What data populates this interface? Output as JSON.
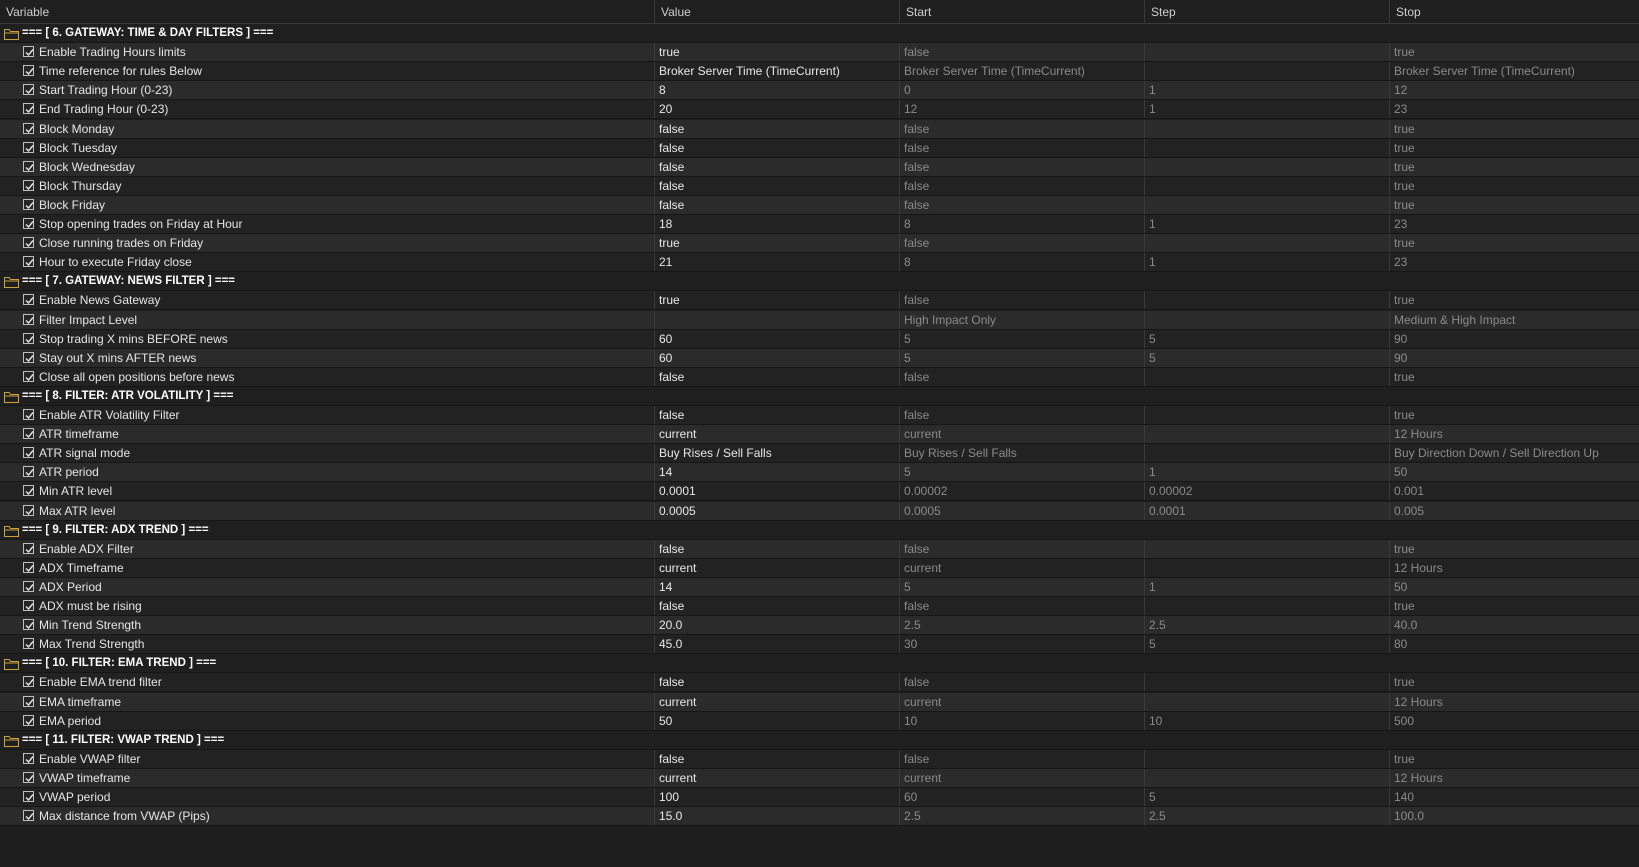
{
  "columns": [
    "Variable",
    "Value",
    "Start",
    "Step",
    "Stop"
  ],
  "rows": [
    {
      "type": "section",
      "title": "=== [ 6. GATEWAY: TIME & DAY FILTERS ] ==="
    },
    {
      "type": "param",
      "name": "Enable Trading Hours limits",
      "value": "true",
      "start": "false",
      "step": "",
      "stop": "true"
    },
    {
      "type": "param",
      "name": "Time reference for rules Below",
      "value": "Broker Server Time (TimeCurrent)",
      "start": "Broker Server Time (TimeCurrent)",
      "step": "",
      "stop": "Broker Server Time (TimeCurrent)"
    },
    {
      "type": "param",
      "name": "Start Trading Hour (0-23)",
      "value": "8",
      "start": "0",
      "step": "1",
      "stop": "12"
    },
    {
      "type": "param",
      "name": "End Trading Hour (0-23)",
      "value": "20",
      "start": "12",
      "step": "1",
      "stop": "23"
    },
    {
      "type": "param",
      "name": "Block Monday",
      "value": "false",
      "start": "false",
      "step": "",
      "stop": "true"
    },
    {
      "type": "param",
      "name": "Block Tuesday",
      "value": "false",
      "start": "false",
      "step": "",
      "stop": "true"
    },
    {
      "type": "param",
      "name": "Block Wednesday",
      "value": "false",
      "start": "false",
      "step": "",
      "stop": "true"
    },
    {
      "type": "param",
      "name": "Block Thursday",
      "value": "false",
      "start": "false",
      "step": "",
      "stop": "true"
    },
    {
      "type": "param",
      "name": "Block Friday",
      "value": "false",
      "start": "false",
      "step": "",
      "stop": "true"
    },
    {
      "type": "param",
      "name": "Stop opening trades on Friday at Hour",
      "value": "18",
      "start": "8",
      "step": "1",
      "stop": "23"
    },
    {
      "type": "param",
      "name": "Close running trades on Friday",
      "value": "true",
      "start": "false",
      "step": "",
      "stop": "true"
    },
    {
      "type": "param",
      "name": "Hour to execute Friday close",
      "value": "21",
      "start": "8",
      "step": "1",
      "stop": "23"
    },
    {
      "type": "section",
      "title": "=== [ 7. GATEWAY: NEWS FILTER ] ==="
    },
    {
      "type": "param",
      "name": "Enable News Gateway",
      "value": "true",
      "start": "false",
      "step": "",
      "stop": "true"
    },
    {
      "type": "param",
      "name": "Filter Impact Level",
      "value": "",
      "start": "High Impact Only",
      "step": "",
      "stop": "Medium & High Impact"
    },
    {
      "type": "param",
      "name": "Stop trading X mins BEFORE news",
      "value": "60",
      "start": "5",
      "step": "5",
      "stop": "90"
    },
    {
      "type": "param",
      "name": "Stay out X mins AFTER news",
      "value": "60",
      "start": "5",
      "step": "5",
      "stop": "90"
    },
    {
      "type": "param",
      "name": "Close all open positions before news",
      "value": "false",
      "start": "false",
      "step": "",
      "stop": "true"
    },
    {
      "type": "section",
      "title": "=== [ 8. FILTER: ATR VOLATILITY ] ==="
    },
    {
      "type": "param",
      "name": "Enable ATR Volatility Filter",
      "value": "false",
      "start": "false",
      "step": "",
      "stop": "true"
    },
    {
      "type": "param",
      "name": "ATR timeframe",
      "value": "current",
      "start": "current",
      "step": "",
      "stop": "12 Hours"
    },
    {
      "type": "param",
      "name": "ATR signal mode",
      "value": "Buy Rises / Sell Falls",
      "start": "Buy Rises / Sell Falls",
      "step": "",
      "stop": "Buy Direction Down / Sell Direction Up"
    },
    {
      "type": "param",
      "name": "ATR period",
      "value": "14",
      "start": "5",
      "step": "1",
      "stop": "50"
    },
    {
      "type": "param",
      "name": "Min ATR level",
      "value": "0.0001",
      "start": "0.00002",
      "step": "0.00002",
      "stop": "0.001"
    },
    {
      "type": "param",
      "name": "Max ATR level",
      "value": "0.0005",
      "start": "0.0005",
      "step": "0.0001",
      "stop": "0.005"
    },
    {
      "type": "section",
      "title": "=== [ 9. FILTER: ADX TREND ] ==="
    },
    {
      "type": "param",
      "name": "Enable ADX Filter",
      "value": "false",
      "start": "false",
      "step": "",
      "stop": "true"
    },
    {
      "type": "param",
      "name": "ADX Timeframe",
      "value": "current",
      "start": "current",
      "step": "",
      "stop": "12 Hours"
    },
    {
      "type": "param",
      "name": "ADX Period",
      "value": "14",
      "start": "5",
      "step": "1",
      "stop": "50"
    },
    {
      "type": "param",
      "name": "ADX must be rising",
      "value": "false",
      "start": "false",
      "step": "",
      "stop": "true"
    },
    {
      "type": "param",
      "name": "Min Trend Strength",
      "value": "20.0",
      "start": "2.5",
      "step": "2.5",
      "stop": "40.0"
    },
    {
      "type": "param",
      "name": "Max Trend Strength",
      "value": "45.0",
      "start": "30",
      "step": "5",
      "stop": "80"
    },
    {
      "type": "section",
      "title": "=== [ 10. FILTER: EMA TREND ] ==="
    },
    {
      "type": "param",
      "name": "Enable EMA trend filter",
      "value": "false",
      "start": "false",
      "step": "",
      "stop": "true"
    },
    {
      "type": "param",
      "name": "EMA timeframe",
      "value": "current",
      "start": "current",
      "step": "",
      "stop": "12 Hours"
    },
    {
      "type": "param",
      "name": "EMA period",
      "value": "50",
      "start": "10",
      "step": "10",
      "stop": "500"
    },
    {
      "type": "section",
      "title": "=== [ 11. FILTER: VWAP TREND ] ==="
    },
    {
      "type": "param",
      "name": "Enable VWAP filter",
      "value": "false",
      "start": "false",
      "step": "",
      "stop": "true"
    },
    {
      "type": "param",
      "name": "VWAP timeframe",
      "value": "current",
      "start": "current",
      "step": "",
      "stop": "12 Hours"
    },
    {
      "type": "param",
      "name": "VWAP period",
      "value": "100",
      "start": "60",
      "step": "5",
      "stop": "140"
    },
    {
      "type": "param",
      "name": "Max distance from VWAP (Pips)",
      "value": "15.0",
      "start": "2.5",
      "step": "2.5",
      "stop": "100.0"
    }
  ],
  "icons": {
    "section": "folder-icon",
    "param_checkbox": "checkbox-checked-icon"
  },
  "colors": {
    "background": "#1e1e1e",
    "row_even": "#222222",
    "row_odd": "#2b2b2b",
    "folder": "#c9a23a",
    "text": "#e8e8e8",
    "muted": "#8a8a8a"
  }
}
